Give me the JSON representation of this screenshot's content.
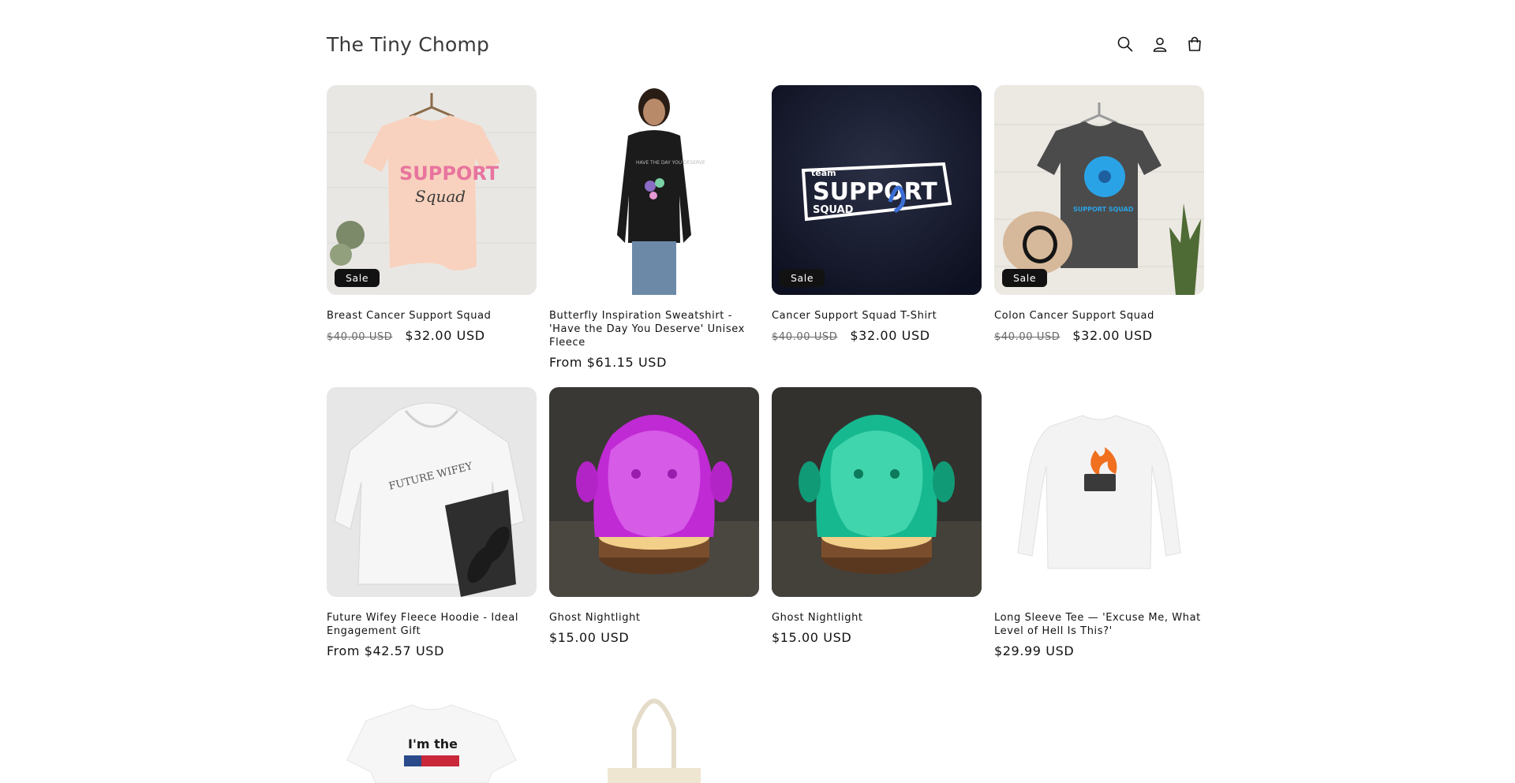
{
  "header": {
    "store_name": "The Tiny Chomp",
    "icons": [
      "search-icon",
      "account-icon",
      "cart-icon"
    ]
  },
  "products": [
    {
      "title": "Breast Cancer Support Squad",
      "badge": "Sale",
      "price_old": "$40.00 USD",
      "price": "$32.00 USD"
    },
    {
      "title": "Butterfly Inspiration Sweatshirt - 'Have the Day You Deserve' Unisex Fleece",
      "badge": "",
      "price_old": "",
      "price": "From $61.15 USD"
    },
    {
      "title": "Cancer Support Squad T-Shirt",
      "badge": "Sale",
      "price_old": "$40.00 USD",
      "price": "$32.00 USD"
    },
    {
      "title": "Colon Cancer Support Squad",
      "badge": "Sale",
      "price_old": "$40.00 USD",
      "price": "$32.00 USD"
    },
    {
      "title": "Future Wifey Fleece Hoodie - Ideal Engagement Gift",
      "badge": "",
      "price_old": "",
      "price": "From $42.57 USD"
    },
    {
      "title": "Ghost Nightlight",
      "badge": "",
      "price_old": "",
      "price": "$15.00 USD"
    },
    {
      "title": "Ghost Nightlight",
      "badge": "",
      "price_old": "",
      "price": "$15.00 USD"
    },
    {
      "title": "Long Sleeve Tee — 'Excuse Me, What Level of Hell Is This?'",
      "badge": "",
      "price_old": "",
      "price": "$29.99 USD"
    }
  ],
  "image_text": {
    "p1_line1": "SUPPORT",
    "p1_line2": "Squad",
    "p2_line": "HAVE THE DAY YOU DESERVE",
    "p3_line0": "team",
    "p3_line1": "SUPPORT",
    "p3_line2": "SQUAD",
    "p4_line": "SUPPORT SQUAD",
    "p5_line": "FUTURE WIFEY",
    "p9_line": "I'm the"
  },
  "colors": {
    "text": "#121212",
    "badge_bg": "#121212",
    "muted": "#6a6a6a"
  }
}
